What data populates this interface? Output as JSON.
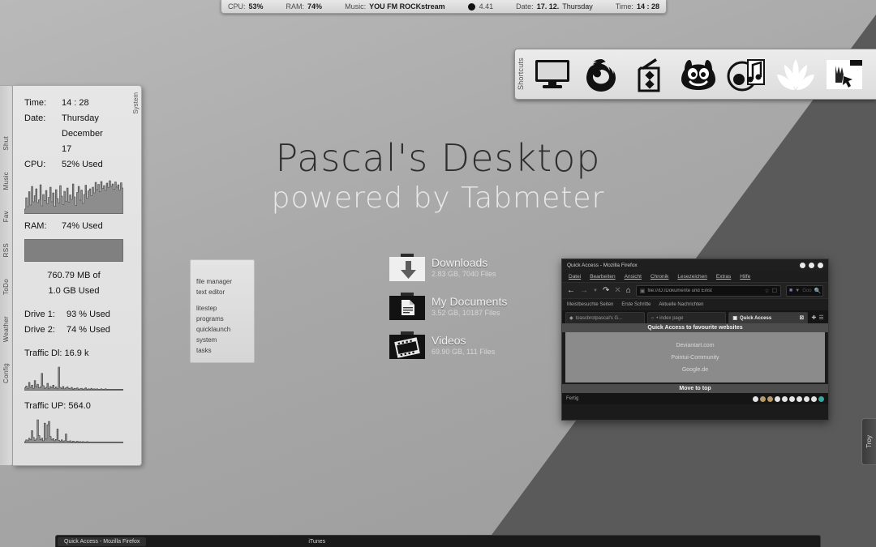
{
  "desktop": {
    "title": "Pascal's Desktop",
    "subtitle": "powered by Tabmeter"
  },
  "topbar": {
    "cpu_label": "CPU:",
    "cpu_value": "53%",
    "ram_label": "RAM:",
    "ram_value": "74%",
    "music_label": "Music:",
    "music_value": "YOU FM ROCKstream",
    "track_time": "4.41",
    "date_label": "Date:",
    "date_value": "17. 12.",
    "weekday": "Thursday",
    "time_label": "Time:",
    "time_value": "14  : 28"
  },
  "shortcuts": {
    "label": "Shortcuts",
    "items": [
      {
        "name": "monitor-icon",
        "title": "Monitor"
      },
      {
        "name": "firefox-icon",
        "title": "Mozilla Firefox"
      },
      {
        "name": "house-folder-icon",
        "title": "File Manager"
      },
      {
        "name": "gimp-wilber-icon",
        "title": "GIMP"
      },
      {
        "name": "itunes-icon",
        "title": "iTunes"
      },
      {
        "name": "flower-icon",
        "title": "Media Player"
      },
      {
        "name": "hand-cursor-icon",
        "title": "Utility"
      }
    ]
  },
  "system_panel": {
    "side_label": "System",
    "tabs": [
      "Shut",
      "Music",
      "Fav",
      "RSS",
      "ToDo",
      "Weather",
      "Config"
    ],
    "time_label": "Time:",
    "time_value": "14  : 28",
    "date_label": "Date:",
    "date_weekday": "Thursday",
    "date_month": "December",
    "date_day": "17",
    "cpu_label": "CPU:",
    "cpu_value": "52% Used",
    "ram_label": "RAM:",
    "ram_value": "74% Used",
    "mem_line1": "760.79 MB of",
    "mem_line2": "1.0 GB Used",
    "drive1_label": "Drive 1:",
    "drive1_value": "93 % Used",
    "drive2_label": "Drive 2:",
    "drive2_value": "74 % Used",
    "traffic_dl": "Traffic Dl: 16.9 k",
    "traffic_up": "Traffic UP: 564.0",
    "cpu_graph": [
      12,
      40,
      18,
      55,
      22,
      68,
      30,
      45,
      62,
      28,
      35,
      72,
      20,
      48,
      33,
      58,
      25,
      41,
      66,
      30,
      52,
      19,
      60,
      38,
      27,
      70,
      44,
      23,
      56,
      31,
      64,
      29,
      47,
      36,
      74,
      42,
      21,
      53,
      68,
      34,
      59,
      26,
      48,
      71,
      39,
      57,
      62,
      45,
      66,
      52,
      78,
      60,
      73,
      55,
      80,
      63,
      70,
      58,
      76,
      65,
      82,
      68,
      74,
      61,
      79,
      66,
      72,
      59,
      77,
      64
    ],
    "dl_graph": [
      6,
      10,
      4,
      18,
      7,
      12,
      5,
      22,
      9,
      14,
      6,
      8,
      38,
      11,
      5,
      7,
      16,
      4,
      9,
      6,
      12,
      5,
      8,
      4,
      52,
      7,
      5,
      9,
      4,
      6,
      8,
      5,
      4,
      7,
      3,
      5,
      4,
      6,
      3,
      4,
      5,
      3,
      4,
      6,
      3,
      4,
      3,
      5,
      3,
      4,
      3,
      4,
      3,
      3,
      4,
      3,
      3,
      4,
      3,
      3,
      3,
      3,
      3,
      3,
      3,
      3,
      3,
      3,
      3,
      3
    ],
    "up_graph": [
      4,
      8,
      6,
      12,
      9,
      30,
      14,
      7,
      10,
      56,
      18,
      9,
      12,
      6,
      48,
      10,
      44,
      52,
      16,
      8,
      11,
      6,
      9,
      34,
      7,
      5,
      8,
      4,
      6,
      22,
      5,
      4,
      6,
      3,
      5,
      4,
      3,
      5,
      3,
      4,
      3,
      4,
      3,
      3,
      4,
      3,
      3,
      3,
      3,
      3,
      3,
      3,
      3,
      3,
      3,
      3,
      3,
      3,
      3,
      3,
      3,
      3,
      3,
      3,
      3,
      3,
      3,
      3,
      3,
      3
    ]
  },
  "quicklaunch": {
    "group1": [
      "file manager",
      "text editor"
    ],
    "group2": [
      "litestep",
      "programs",
      "quicklaunch",
      "system",
      "tasks"
    ]
  },
  "desktop_icons": [
    {
      "name": "Downloads",
      "meta": "2.83 GB, 7040 Files",
      "icon": "download-arrow-icon"
    },
    {
      "name": "My Documents",
      "meta": "3.52 GB, 10187 Files",
      "icon": "document-icon"
    },
    {
      "name": "Videos",
      "meta": "69.90 GB, 111 Files",
      "icon": "film-reel-icon"
    }
  ],
  "firefox": {
    "window_title": "Quick Access - Mozilla Firefox",
    "menu": [
      "Datei",
      "Bearbeiten",
      "Ansicht",
      "Chronik",
      "Lesezeichen",
      "Extras",
      "Hilfe"
    ],
    "url": "file:///D:/Dokumente und Einst",
    "search_placeholder": "Goo",
    "bookmarks": [
      "Meistbesuchte Seiten",
      "Erste Schritte",
      "Aktuelle Nachrichten"
    ],
    "tabs": [
      {
        "label": "toascbrotpascal's G...",
        "active": false
      },
      {
        "label": "• index page",
        "active": false
      },
      {
        "label": "Quick Access",
        "active": true
      }
    ],
    "page_header": "Quick Access to favourite websites",
    "page_links": [
      "Deviantart.com",
      "Pointui-Community",
      "Google.de"
    ],
    "page_footer": "Move to top",
    "status": "Fertig"
  },
  "edge_tab": {
    "label": "Troy"
  },
  "taskbar": {
    "items": [
      {
        "label": "Quick Access - Mozilla Firefox",
        "selected": true
      },
      {
        "label": "iTunes",
        "selected": false
      }
    ]
  }
}
